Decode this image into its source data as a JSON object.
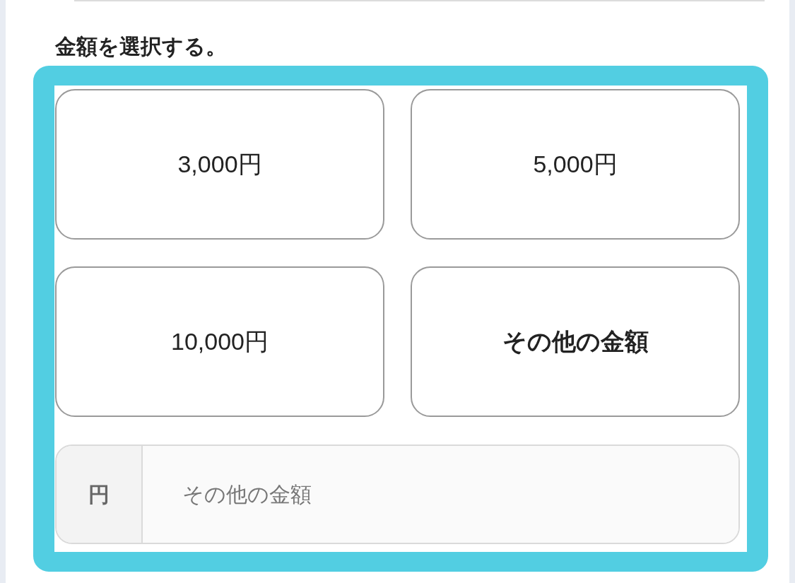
{
  "heading": "金額を選択する。",
  "amount_options": [
    {
      "label": "3,000円",
      "kind": "preset",
      "selected": false
    },
    {
      "label": "5,000円",
      "kind": "preset",
      "selected": false
    },
    {
      "label": "10,000円",
      "kind": "preset",
      "selected": false
    },
    {
      "label": "その他の金額",
      "kind": "other",
      "selected": false
    }
  ],
  "other_amount_field": {
    "prefix": "円",
    "placeholder": "その他の金額"
  }
}
